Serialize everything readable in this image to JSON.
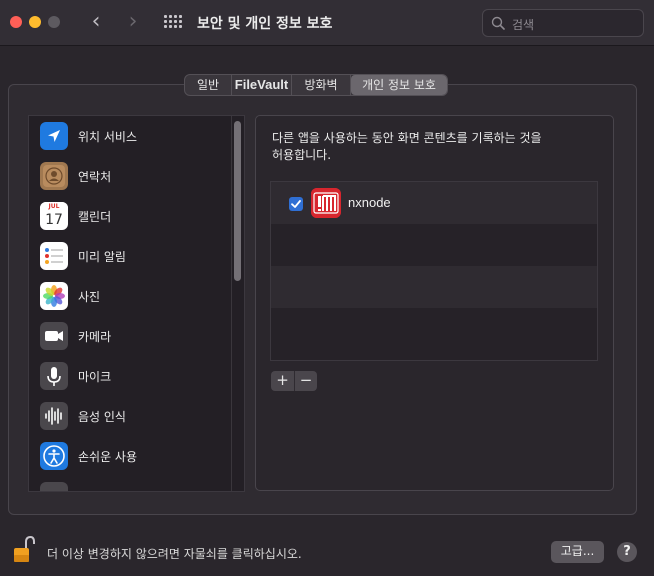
{
  "window": {
    "title": "보안 및 개인 정보 보호",
    "search_placeholder": "검색"
  },
  "tabs": [
    {
      "label": "일반"
    },
    {
      "label": "FileVault"
    },
    {
      "label": "방화벽"
    },
    {
      "label": "개인 정보 보호",
      "selected": true
    }
  ],
  "sidebar": {
    "items": [
      {
        "label": "위치 서비스",
        "icon": "location-arrow-icon"
      },
      {
        "label": "연락처",
        "icon": "contacts-icon"
      },
      {
        "label": "캘린더",
        "icon": "calendar-icon",
        "icon_month": "JUL",
        "icon_day": "17"
      },
      {
        "label": "미리 알림",
        "icon": "reminders-icon"
      },
      {
        "label": "사진",
        "icon": "photos-icon"
      },
      {
        "label": "카메라",
        "icon": "camera-icon"
      },
      {
        "label": "마이크",
        "icon": "microphone-icon"
      },
      {
        "label": "음성 인식",
        "icon": "speech-recognition-icon"
      },
      {
        "label": "손쉬운 사용",
        "icon": "accessibility-icon"
      }
    ]
  },
  "detail": {
    "description": "다른 앱을 사용하는 동안 화면 콘텐츠를 기록하는 것을 허용합니다.",
    "apps": [
      {
        "name": "nxnode",
        "checked": true,
        "icon": "nxnode-app-icon"
      }
    ],
    "add_label": "+",
    "remove_label": "−"
  },
  "footer": {
    "lock_text": "더 이상 변경하지 않으려면 자물쇠를 클릭하십시오.",
    "advanced_label": "고급...",
    "help_label": "?"
  },
  "colors": {
    "accent": "#2f6fd4",
    "close": "#fe5f57",
    "minimize": "#febc2e",
    "app_icon_red": "#d7262e"
  }
}
